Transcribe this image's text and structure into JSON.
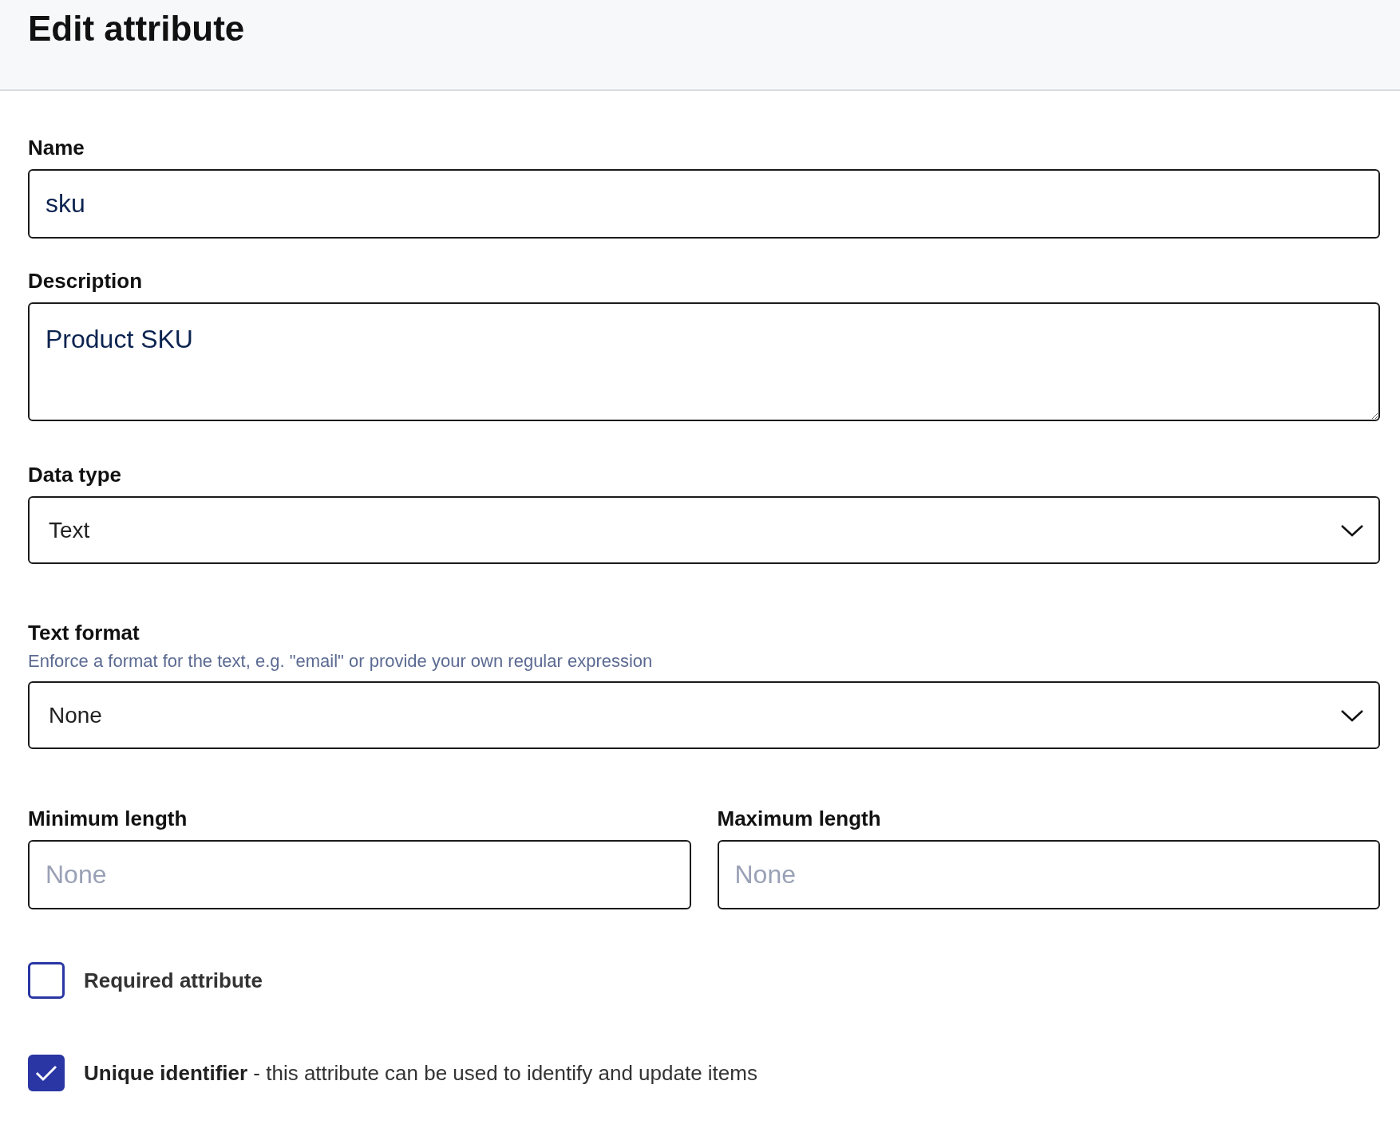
{
  "title": "Edit attribute",
  "fields": [
    {
      "kind": "text",
      "label": "Name",
      "value": "sku"
    },
    {
      "kind": "textarea",
      "label": "Description",
      "value": "Product SKU"
    },
    {
      "kind": "select",
      "label": "Data type",
      "value": "Text"
    },
    {
      "kind": "select",
      "label": "Text format",
      "hint": "Enforce a format for the text, e.g. \"email\" or provide your own regular expression",
      "value": "None"
    },
    {
      "kind": "pair",
      "items": [
        {
          "label": "Minimum length",
          "placeholder": "None"
        },
        {
          "label": "Maximum length",
          "placeholder": "None"
        }
      ]
    }
  ],
  "options": [
    {
      "label": "Required attribute",
      "checked": false
    },
    {
      "label": "**Unique identifier** - this attribute can be used to identify and update items",
      "checked": true
    }
  ]
}
